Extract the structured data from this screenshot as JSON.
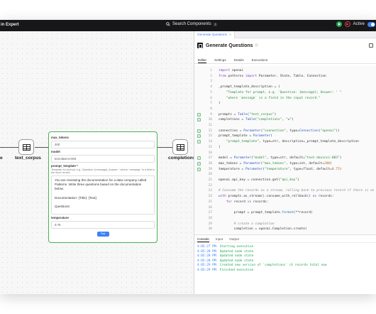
{
  "app": {
    "title": "in Expert",
    "search_label": "Search Components",
    "search_shortcut": "/",
    "status_label": "Active"
  },
  "canvas": {
    "left_label": "e",
    "source_node": "text_corpus",
    "target_node": "completions",
    "card": {
      "max_tokens_label": "max_tokens",
      "max_tokens_value": "200",
      "model_label": "model",
      "model_value": "text-davinci-003",
      "prompt_template_label": "prompt_template *",
      "prompt_template_desc": "Template for prompt, e.g. 'Question: {message}; Answer: ' where `message` is a field in the input record.",
      "prompt_lines": [
        "You are reviewing the documentation for a data company called",
        "Patterns. Write three questions based on the documentation below.",
        "",
        "Documentation: {Title}: {Text}",
        "",
        "Questions:"
      ],
      "temperature_label": "temperature",
      "temperature_value": "0.75",
      "test_button": "Test"
    }
  },
  "panel": {
    "file_tab": "Generate Questions",
    "file_tab_close": "×",
    "title": "Generate Questions",
    "title_hint": "⊡",
    "subtabs": [
      "Editor",
      "Settings",
      "Details",
      "Executions"
    ],
    "code_lines": [
      {
        "n": "1",
        "html": "<span class='kw'>import</span> openai"
      },
      {
        "n": "2",
        "html": "<span class='kw'>from</span> patterns <span class='kw'>import</span> Parameter, State, Table, Connection"
      },
      {
        "n": "3",
        "html": ""
      },
      {
        "n": "4",
        "html": "_prompt_template_description = ("
      },
      {
        "n": "5",
        "html": "    <span class='str'>\"Template for prompt, e.g. 'Question: {message}; Answer: ' \"</span>"
      },
      {
        "n": "6",
        "html": "    <span class='str'>\"where `message` is a field in the input record.\"</span>"
      },
      {
        "n": "7",
        "html": ")"
      },
      {
        "n": "8",
        "html": ""
      },
      {
        "n": "9",
        "html": "prompts = <span class='fn'>Table</span>(<span class='str'>\"text_corpus\"</span>)"
      },
      {
        "n": "10",
        "html": "completions = <span class='fn'>Table</span>(<span class='str'>\"completions\"</span>, <span class='str'>\"w\"</span>)"
      },
      {
        "n": "11",
        "html": ""
      },
      {
        "n": "12",
        "html": "connection = <span class='fn'>Parameter</span>(<span class='str'>\"connection\"</span>, type=<span class='fn'>Connection</span>(<span class='str'>\"openai\"</span>))"
      },
      {
        "n": "13",
        "html": "prompt_template = <span class='fn'>Parameter</span>("
      },
      {
        "n": "14",
        "html": "    <span class='str'>\"prompt_template\"</span>, type=str, description=_prompt_template_description"
      },
      {
        "n": "15",
        "html": ")"
      },
      {
        "n": "16",
        "html": ""
      },
      {
        "n": "17",
        "html": "model = <span class='fn'>Parameter</span>(<span class='str'>\"model\"</span>, type=str, default=<span class='str'>\"text-davinci-003\"</span>)"
      },
      {
        "n": "18",
        "html": "max_tokens = <span class='fn'>Parameter</span>(<span class='str'>\"max_tokens\"</span>, type=int, default=<span class='num'>200</span>)"
      },
      {
        "n": "19",
        "html": "temperature = <span class='fn'>Parameter</span>(<span class='str'>\"temperature\"</span>, type=float, default=<span class='num'>0.75</span>)"
      },
      {
        "n": "20",
        "html": ""
      },
      {
        "n": "21",
        "html": "openai.api_key = connection.get(<span class='str'>\"api_key\"</span>)"
      },
      {
        "n": "22",
        "html": ""
      },
      {
        "n": "23",
        "html": "<span class='com'># Consume the records as a stream, rolling back to previous record if there is an</span>"
      },
      {
        "n": "24",
        "html": "<span class='kw'>with</span> prompts.as_stream().consume_with_rollback() <span class='kw'>as</span> records:"
      },
      {
        "n": "25",
        "html": "    <span class='kw'>for</span> record <span class='kw'>in</span> records:"
      },
      {
        "n": "26",
        "html": ""
      },
      {
        "n": "27",
        "html": "        prompt = prompt_template.<span class='fn'>format</span>(**record)"
      },
      {
        "n": "28",
        "html": ""
      },
      {
        "n": "29",
        "html": "        <span class='com'># create a completion</span>"
      },
      {
        "n": "30",
        "html": "        completion = openai.Completion.create("
      }
    ],
    "console_tabs": [
      "Console",
      "Input",
      "Output"
    ],
    "logs": [
      {
        "time": "4:05:27 PM:",
        "msg": "Starting execution"
      },
      {
        "time": "4:05:28 PM:",
        "msg": "Updated node state"
      },
      {
        "time": "4:05:28 PM:",
        "msg": "Updated node state"
      },
      {
        "time": "4:05:28 PM:",
        "msg": "Updated node state"
      },
      {
        "time": "4:05:29 PM:",
        "msg": "Created new version of 'completions' (4 records total now"
      },
      {
        "time": "4:05:29 PM:",
        "msg": "Finished execution"
      }
    ]
  },
  "colors": {
    "accent": "#3b82f6",
    "node_border": "#4caf50",
    "topbar": "#17171a"
  }
}
